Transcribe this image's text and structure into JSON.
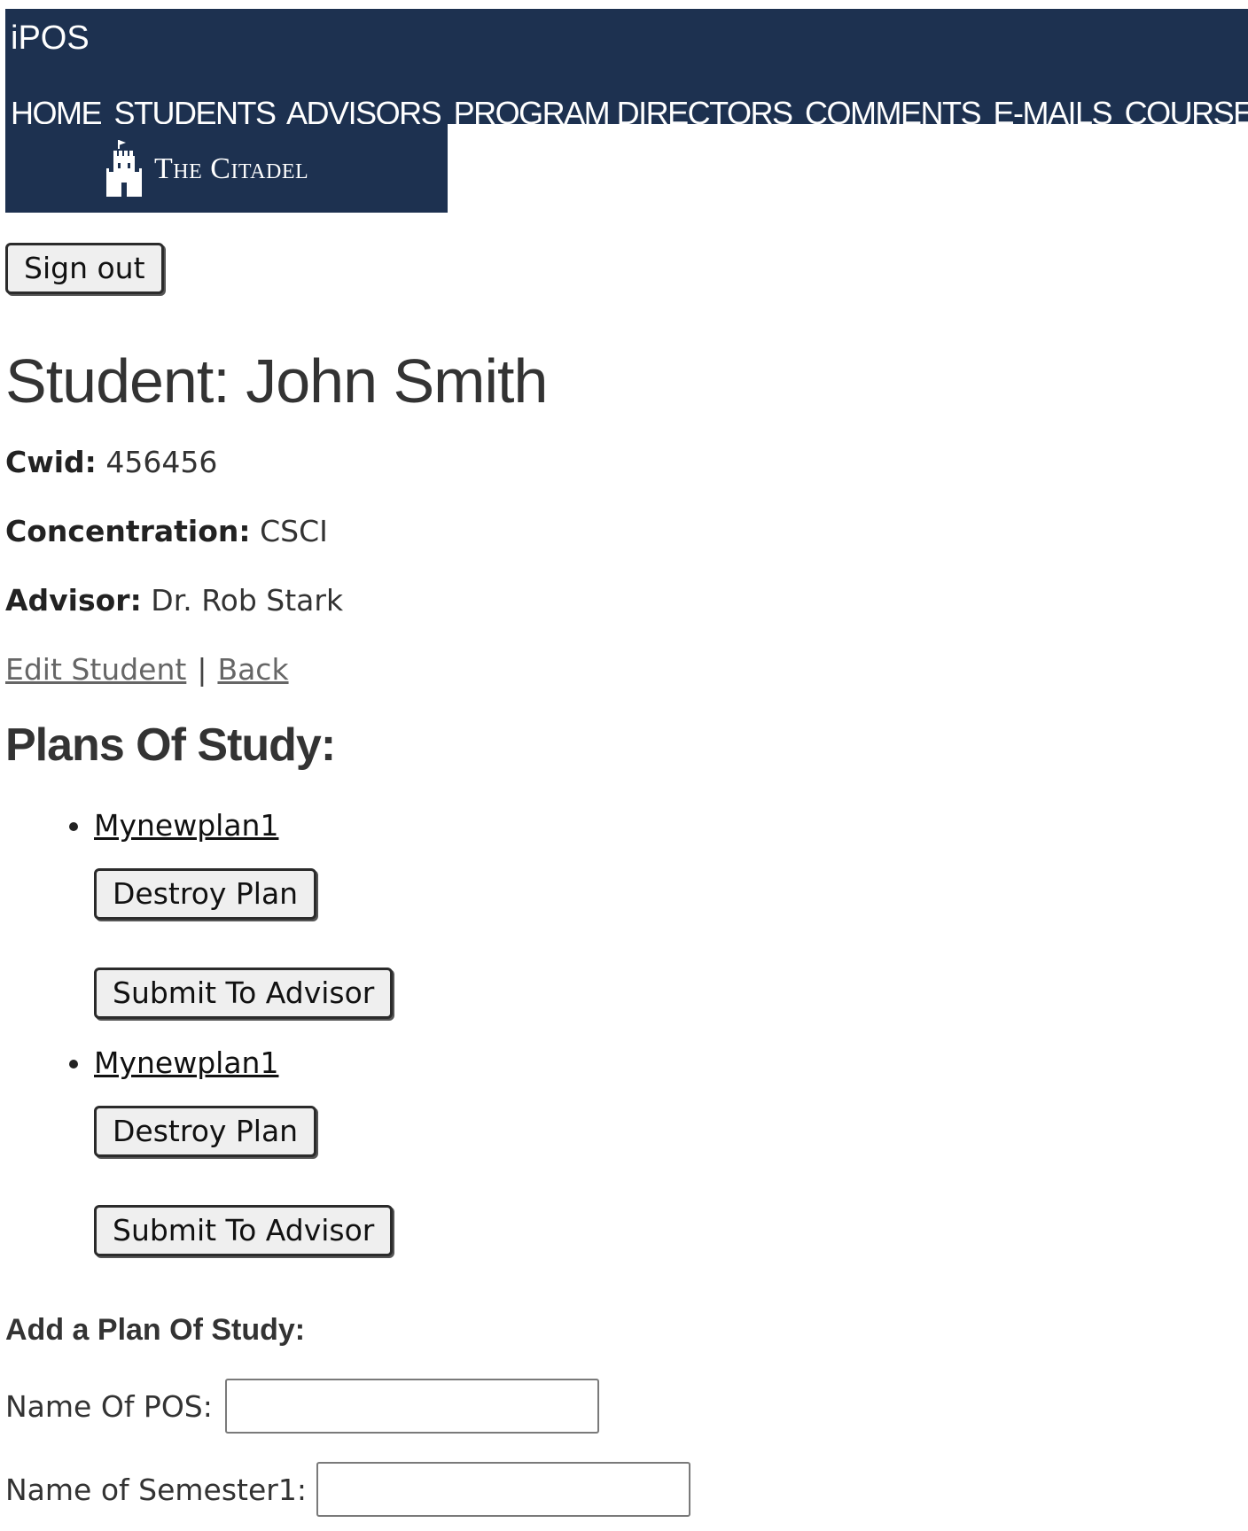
{
  "header": {
    "app_title": "iPOS",
    "nav": [
      "HOME",
      "STUDENTS",
      "ADVISORS",
      "PROGRAM DIRECTORS",
      "COMMENTS",
      "E-MAILS",
      "COURSES"
    ]
  },
  "logo": {
    "text": "The Citadel"
  },
  "sign_out_label": "Sign out",
  "student": {
    "title": "Student: John Smith",
    "cwid_label": "Cwid:",
    "cwid": "456456",
    "concentration_label": "Concentration:",
    "concentration": "CSCI",
    "advisor_label": "Advisor:",
    "advisor": "Dr. Rob Stark"
  },
  "links": {
    "edit": "Edit Student",
    "separator": "|",
    "back": "Back"
  },
  "plans": {
    "title": "Plans Of Study:",
    "items": [
      {
        "name": "Mynewplan1",
        "destroy_label": "Destroy Plan",
        "submit_label": "Submit To Advisor"
      },
      {
        "name": "Mynewplan1",
        "destroy_label": "Destroy Plan",
        "submit_label": "Submit To Advisor"
      }
    ]
  },
  "add_form": {
    "title": "Add a Plan Of Study:",
    "name_label": "Name Of POS:",
    "name_value": "",
    "semester_label": "Name of Semester1:",
    "semester_value": ""
  }
}
